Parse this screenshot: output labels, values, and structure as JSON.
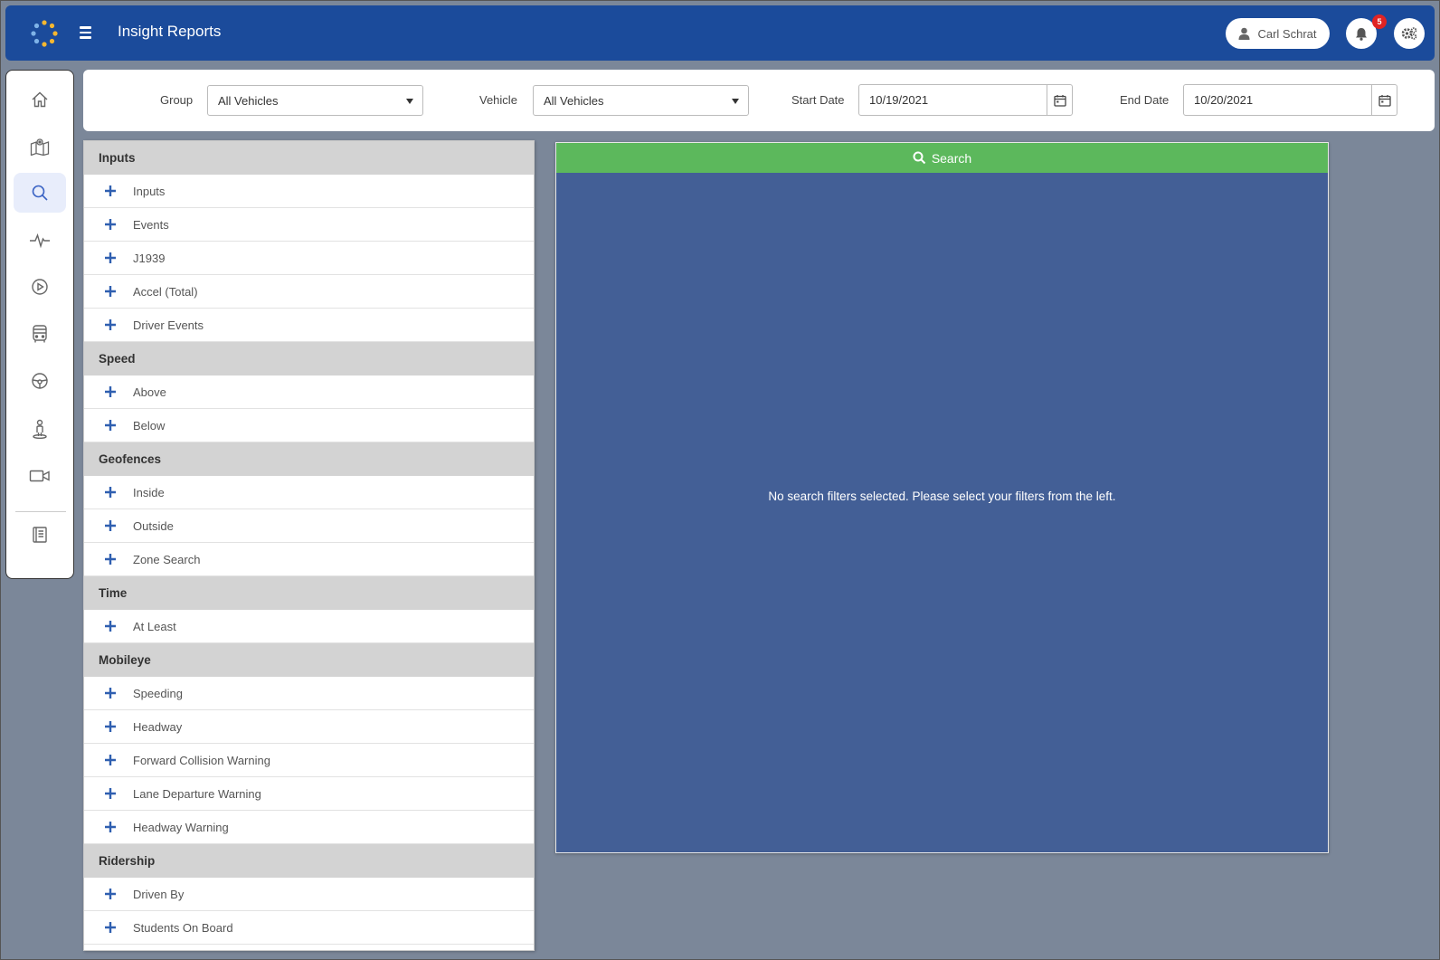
{
  "app": {
    "title": "Insight Reports"
  },
  "header": {
    "user_name": "Carl Schrat",
    "notification_count": "5",
    "icons": [
      "logo-icon",
      "menu-icon",
      "user-icon",
      "bell-icon",
      "settings-gear-icon"
    ]
  },
  "sidebar": {
    "items": [
      {
        "name": "home",
        "icon": "home-icon",
        "active": false
      },
      {
        "name": "map",
        "icon": "map-icon",
        "active": false
      },
      {
        "name": "search",
        "icon": "search-icon",
        "active": true
      },
      {
        "name": "activity",
        "icon": "pulse-icon",
        "active": false
      },
      {
        "name": "playback",
        "icon": "play-circle-icon",
        "active": false
      },
      {
        "name": "bus",
        "icon": "bus-icon",
        "active": false
      },
      {
        "name": "driver",
        "icon": "steering-wheel-icon",
        "active": false
      },
      {
        "name": "stop",
        "icon": "person-pin-icon",
        "active": false
      },
      {
        "name": "video",
        "icon": "video-camera-icon",
        "active": false
      },
      {
        "name": "reports",
        "icon": "book-icon",
        "active": false
      }
    ]
  },
  "filterbar": {
    "group_label": "Group",
    "group_value": "All Vehicles",
    "vehicle_label": "Vehicle",
    "vehicle_value": "All Vehicles",
    "start_label": "Start Date",
    "start_value": "10/19/2021",
    "end_label": "End Date",
    "end_value": "10/20/2021"
  },
  "filters": [
    {
      "section": "Inputs",
      "items": [
        "Inputs",
        "Events",
        "J1939",
        "Accel (Total)",
        "Driver Events"
      ]
    },
    {
      "section": "Speed",
      "items": [
        "Above",
        "Below"
      ]
    },
    {
      "section": "Geofences",
      "items": [
        "Inside",
        "Outside",
        "Zone Search"
      ]
    },
    {
      "section": "Time",
      "items": [
        "At Least"
      ]
    },
    {
      "section": "Mobileye",
      "items": [
        "Speeding",
        "Headway",
        "Forward Collision Warning",
        "Lane Departure Warning",
        "Headway Warning"
      ]
    },
    {
      "section": "Ridership",
      "items": [
        "Driven By",
        "Students On Board"
      ]
    }
  ],
  "results": {
    "search_label": "Search",
    "empty_message": "No search filters selected. Please select your filters from the left."
  },
  "colors": {
    "header": "#1b4b9b",
    "search_green": "#5cb85c",
    "results_bg": "#435f96",
    "plus_blue": "#2f5fb0",
    "badge_red": "#e02424"
  }
}
